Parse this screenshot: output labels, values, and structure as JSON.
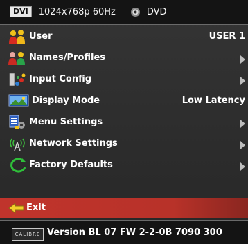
{
  "status_bar": {
    "input_badge": "DVI",
    "resolution": "1024x768p 60Hz",
    "source_icon": "disc-icon",
    "source": "DVD"
  },
  "menu": {
    "items": [
      {
        "label": "User",
        "value": "USER 1",
        "icon": "user-icon"
      },
      {
        "label": "Names/Profiles",
        "value": "",
        "icon": "profiles-icon"
      },
      {
        "label": "Input Config",
        "value": "",
        "icon": "input-config-icon"
      },
      {
        "label": "Display Mode",
        "value": "Low Latency",
        "icon": "display-icon"
      },
      {
        "label": "Menu Settings",
        "value": "",
        "icon": "menu-settings-icon"
      },
      {
        "label": "Network Settings",
        "value": "",
        "icon": "network-icon"
      },
      {
        "label": "Factory Defaults",
        "value": "",
        "icon": "factory-defaults-icon"
      }
    ]
  },
  "exit": {
    "label": "Exit",
    "icon": "back-arrow-icon"
  },
  "footer": {
    "logo_text": "CALIBRE",
    "version": "Version BL 07 FW 2-2-0B 7090 300"
  },
  "colors": {
    "exit_highlight": "#c0342c",
    "panel": "#303030",
    "bar": "#141414"
  }
}
